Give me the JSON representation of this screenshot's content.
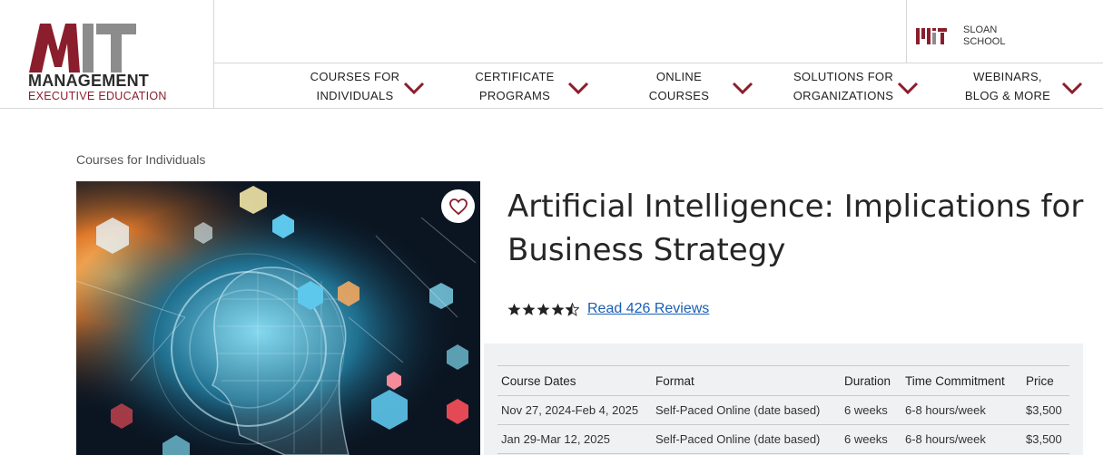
{
  "brand": {
    "logo_letters": "MIT",
    "logo_line1": "MANAGEMENT",
    "logo_line2": "EXECUTIVE EDUCATION",
    "school_logo": "MIT",
    "school_line1": "SLOAN",
    "school_line2": "SCHOOL",
    "accent_color": "#8a1e2c",
    "gray_color": "#8c8c8c"
  },
  "nav": {
    "items": [
      {
        "line1": "COURSES FOR",
        "line2": "INDIVIDUALS",
        "icon": "chevron-down-icon"
      },
      {
        "line1": "CERTIFICATE",
        "line2": "PROGRAMS",
        "icon": "chevron-down-icon"
      },
      {
        "line1": "ONLINE",
        "line2": "COURSES",
        "icon": "chevron-down-icon"
      },
      {
        "line1": "SOLUTIONS FOR",
        "line2": "ORGANIZATIONS",
        "icon": "chevron-down-icon"
      },
      {
        "line1": "WEBINARS,",
        "line2": "BLOG & MORE",
        "icon": "chevron-down-icon"
      }
    ]
  },
  "breadcrumb": "Courses for Individuals",
  "course": {
    "title": "Artificial Intelligence: Implications for Business Strategy",
    "rating": 4.5,
    "reviews_link": "Read 426 Reviews",
    "favorite_icon": "heart-icon"
  },
  "table": {
    "headers": [
      "Course Dates",
      "Format",
      "Duration",
      "Time Commitment",
      "Price"
    ],
    "rows": [
      [
        "Nov 27, 2024-Feb 4, 2025",
        "Self-Paced Online (date based)",
        "6 weeks",
        "6-8 hours/week",
        "$3,500"
      ],
      [
        "Jan 29-Mar 12, 2025",
        "Self-Paced Online (date based)",
        "6 weeks",
        "6-8 hours/week",
        "$3,500"
      ]
    ]
  }
}
